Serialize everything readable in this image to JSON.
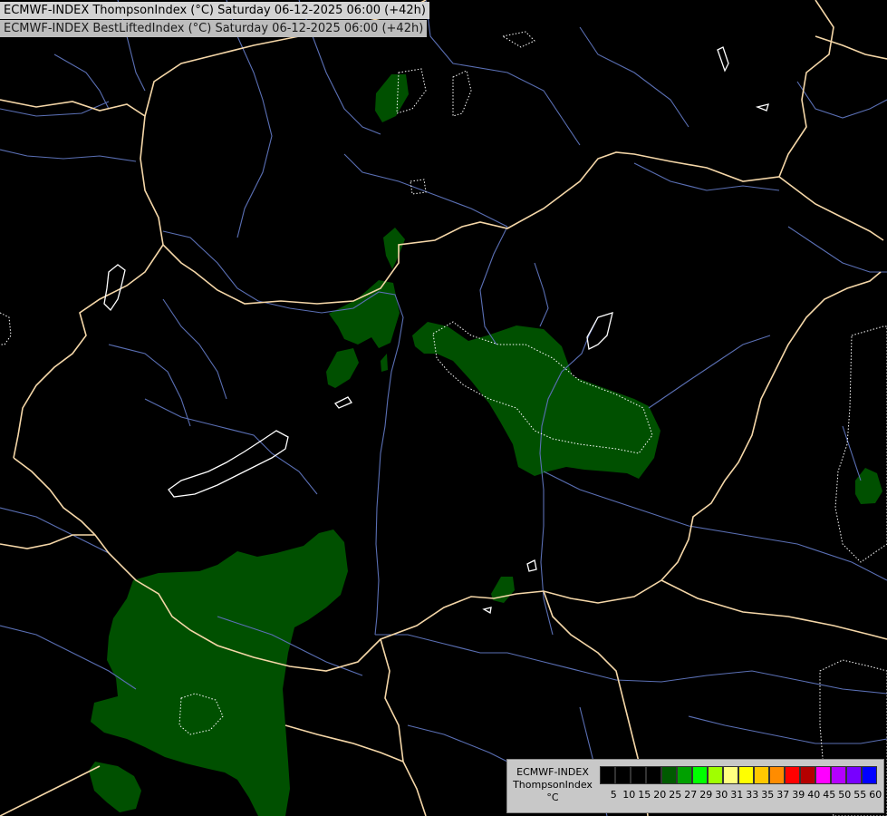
{
  "header": {
    "line1": "ECMWF-INDEX ThompsonIndex (°C) Saturday 06-12-2025 06:00 (+42h)",
    "line2": "ECMWF-INDEX BestLiftedIndex (°C) Saturday 06-12-2025 06:00 (+42h)"
  },
  "legend": {
    "model": "ECMWF-INDEX",
    "variable": "ThompsonIndex",
    "unit": "°C",
    "ticks": [
      "5",
      "10",
      "15",
      "20",
      "25",
      "27",
      "29",
      "30",
      "31",
      "33",
      "35",
      "37",
      "39",
      "40",
      "45",
      "50",
      "55",
      "60"
    ],
    "colors": [
      "#000000",
      "#000000",
      "#000000",
      "#000000",
      "#005a00",
      "#00a000",
      "#00ff00",
      "#a0ff00",
      "#ffff80",
      "#ffff00",
      "#ffc800",
      "#ff8c00",
      "#ff0000",
      "#b40000",
      "#ff00ff",
      "#b400ff",
      "#7800ff",
      "#0000ff"
    ]
  },
  "map": {
    "background": "#000000",
    "field_color": "#005000",
    "border_color": "#f5d7a8",
    "river_color": "#5a6fb4"
  }
}
